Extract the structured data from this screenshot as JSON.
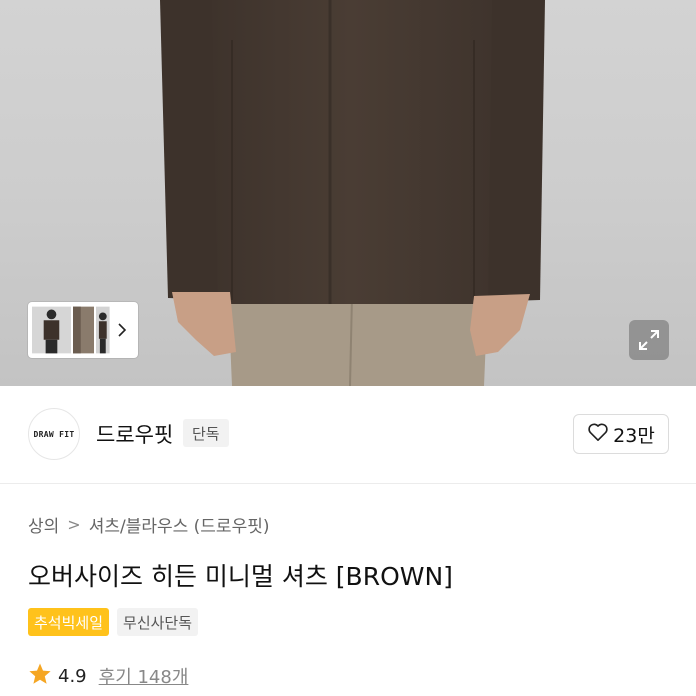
{
  "gallery": {
    "thumbnail_next_icon": "chevron-right-icon",
    "expand_icon": "expand-arrows-icon"
  },
  "brand": {
    "logo_text": "DRAW FIT",
    "name": "드로우핏",
    "badge": "단독",
    "like_icon": "heart-outline-icon",
    "like_count": "23만"
  },
  "breadcrumb": {
    "level1": "상의",
    "separator": ">",
    "level2": "셔츠/블라우스 (드로우핏)"
  },
  "product": {
    "title": "오버사이즈 히든 미니멀 셔츠 [BROWN]",
    "tags": [
      "추석빅세일",
      "무신사단독"
    ],
    "rating": "4.9",
    "reviews": "후기 148개"
  },
  "colors": {
    "sale_tag": "#ffc21b",
    "star": "#f5a623",
    "shirt": "#4a3d34",
    "pants": "#a79a88"
  }
}
